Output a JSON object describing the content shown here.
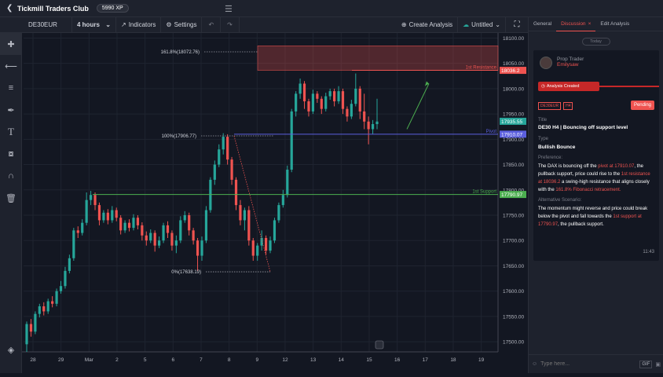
{
  "app": {
    "title": "Tickmill Traders Club",
    "xp": "5990 XP"
  },
  "toolbar": {
    "symbol": "DE30EUR",
    "interval": "4 hours",
    "indicators": "Indicators",
    "settings": "Settings",
    "create_analysis": "Create Analysis",
    "layout_name": "Untitled"
  },
  "tools": [
    "crosshair-icon",
    "horizontal-line-icon",
    "fib-retracement-icon",
    "brush-icon",
    "text-icon",
    "pattern-icon",
    "magnet-icon",
    "trash-icon"
  ],
  "colors": {
    "up": "#26a69a",
    "down": "#ef5350",
    "pivot": "#5b5fde",
    "support": "#4caf50",
    "resistance": "#ef5350"
  },
  "chart_data": {
    "type": "candlestick",
    "symbol": "DE30EUR",
    "interval": "4 hours",
    "ylim": [
      17480,
      18110
    ],
    "y_ticks": [
      17500,
      17550,
      17600,
      17650,
      17700,
      17750,
      17800,
      17850,
      17900,
      17950,
      18000,
      18050,
      18100
    ],
    "y_tick_labels": [
      "17500.00",
      "17550.00",
      "17600.00",
      "17650.00",
      "17700.00",
      "17750.00",
      "17800.00",
      "17850.00",
      "17900.00",
      "17950.00",
      "18000.00",
      "18050.00",
      "18100.00"
    ],
    "x_tick_labels": [
      "28",
      "29",
      "Mar",
      "2",
      "5",
      "6",
      "7",
      "8",
      "9",
      "12",
      "13",
      "14",
      "15",
      "16",
      "17",
      "18",
      "19"
    ],
    "candles": [
      [
        17495,
        17535,
        17480,
        17540
      ],
      [
        17535,
        17520,
        17510,
        17545
      ],
      [
        17520,
        17555,
        17515,
        17560
      ],
      [
        17555,
        17570,
        17548,
        17575
      ],
      [
        17570,
        17560,
        17552,
        17578
      ],
      [
        17560,
        17580,
        17555,
        17585
      ],
      [
        17580,
        17575,
        17568,
        17590
      ],
      [
        17575,
        17600,
        17570,
        17605
      ],
      [
        17600,
        17610,
        17595,
        17620
      ],
      [
        17610,
        17640,
        17605,
        17648
      ],
      [
        17640,
        17665,
        17635,
        17672
      ],
      [
        17665,
        17720,
        17660,
        17725
      ],
      [
        17720,
        17715,
        17705,
        17728
      ],
      [
        17715,
        17735,
        17710,
        17742
      ],
      [
        17735,
        17780,
        17730,
        17795
      ],
      [
        17780,
        17790,
        17770,
        17798
      ],
      [
        17790,
        17770,
        17760,
        17795
      ],
      [
        17770,
        17740,
        17730,
        17775
      ],
      [
        17740,
        17755,
        17735,
        17760
      ],
      [
        17755,
        17740,
        17732,
        17762
      ],
      [
        17740,
        17760,
        17735,
        17768
      ],
      [
        17760,
        17745,
        17738,
        17765
      ],
      [
        17745,
        17720,
        17712,
        17750
      ],
      [
        17720,
        17735,
        17715,
        17740
      ],
      [
        17735,
        17725,
        17718,
        17742
      ],
      [
        17725,
        17745,
        17720,
        17752
      ],
      [
        17745,
        17730,
        17722,
        17750
      ],
      [
        17730,
        17710,
        17700,
        17736
      ],
      [
        17710,
        17700,
        17690,
        17718
      ],
      [
        17700,
        17715,
        17695,
        17722
      ],
      [
        17715,
        17690,
        17678,
        17720
      ],
      [
        17690,
        17700,
        17685,
        17708
      ],
      [
        17700,
        17730,
        17695,
        17735
      ],
      [
        17730,
        17715,
        17705,
        17738
      ],
      [
        17715,
        17690,
        17680,
        17720
      ],
      [
        17690,
        17700,
        17675,
        17710
      ],
      [
        17700,
        17740,
        17695,
        17748
      ],
      [
        17740,
        17750,
        17735,
        17758
      ],
      [
        17750,
        17720,
        17710,
        17755
      ],
      [
        17720,
        17700,
        17692,
        17725
      ],
      [
        17700,
        17670,
        17640,
        17705
      ],
      [
        17670,
        17700,
        17660,
        17708
      ],
      [
        17700,
        17760,
        17695,
        17768
      ],
      [
        17760,
        17820,
        17755,
        17825
      ],
      [
        17820,
        17850,
        17810,
        17858
      ],
      [
        17850,
        17880,
        17845,
        17890
      ],
      [
        17880,
        17905,
        17870,
        17912
      ],
      [
        17905,
        17860,
        17850,
        17910
      ],
      [
        17860,
        17820,
        17810,
        17865
      ],
      [
        17820,
        17770,
        17760,
        17825
      ],
      [
        17770,
        17740,
        17730,
        17780
      ],
      [
        17740,
        17760,
        17720,
        17765
      ],
      [
        17760,
        17700,
        17690,
        17768
      ],
      [
        17700,
        17670,
        17660,
        17705
      ],
      [
        17670,
        17690,
        17660,
        17695
      ],
      [
        17690,
        17705,
        17680,
        17720
      ],
      [
        17705,
        17680,
        17672,
        17710
      ],
      [
        17680,
        17700,
        17675,
        17708
      ],
      [
        17700,
        17740,
        17695,
        17745
      ],
      [
        17740,
        17770,
        17735,
        17775
      ],
      [
        17770,
        17790,
        17765,
        17800
      ],
      [
        17790,
        17840,
        17785,
        17848
      ],
      [
        17840,
        17955,
        17835,
        17960
      ],
      [
        17955,
        17990,
        17945,
        17995
      ],
      [
        17990,
        18010,
        17980,
        18020
      ],
      [
        18010,
        17975,
        17960,
        18015
      ],
      [
        17975,
        17955,
        17945,
        17980
      ],
      [
        17955,
        17990,
        17950,
        17998
      ],
      [
        17990,
        17980,
        17972,
        17995
      ],
      [
        17980,
        17960,
        17950,
        17985
      ],
      [
        17960,
        17985,
        17955,
        17992
      ],
      [
        17985,
        17995,
        17978,
        18000
      ],
      [
        17995,
        17975,
        17965,
        18000
      ],
      [
        17975,
        17995,
        17970,
        18005
      ],
      [
        17995,
        17960,
        17950,
        18000
      ],
      [
        17960,
        17945,
        17935,
        17965
      ],
      [
        17945,
        17970,
        17940,
        17978
      ],
      [
        17970,
        18000,
        17965,
        18030
      ],
      [
        18000,
        17955,
        17940,
        18005
      ],
      [
        17955,
        17935,
        17920,
        17990
      ],
      [
        17935,
        17920,
        17890,
        17945
      ],
      [
        17920,
        17930,
        17910,
        17938
      ],
      [
        17930,
        17935,
        17920,
        17980
      ]
    ],
    "levels": [
      {
        "label": "1st Resistance",
        "price_label": "18036.2",
        "value": 18036.2
      },
      {
        "label": "Pivot",
        "price_label": "17910.07",
        "value": 17910.07
      },
      {
        "label": "1st Support",
        "price_label": "17790.97",
        "value": 17790.97
      }
    ],
    "last_price_label": "17935.55",
    "last_price": 17935.55,
    "fibonacci": [
      {
        "label": "161.8%(18072.76)",
        "value": 18072.76
      },
      {
        "label": "100%(17906.77)",
        "value": 17906.77
      },
      {
        "label": "0%(17638.19)",
        "value": 17638.19
      }
    ]
  },
  "panel": {
    "tabs": [
      "General",
      "Discussion",
      "Edit Analysis"
    ],
    "today": "Today",
    "author_role": "Prop Trader",
    "author_name": "Emilysaw",
    "created": "Analysis Created",
    "tags": [
      "DE30EUR",
      "H4"
    ],
    "status": "Pending",
    "title_label": "Title",
    "title_value": "DE30 H4 | Bouncing off support level",
    "type_label": "Type",
    "type_value": "Bullish Bounce",
    "pref_label": "Preference:",
    "pref_parts": [
      "The DAX is bouncing off the ",
      "pivot at 17910.07",
      ", the pullback support, price could rise to the ",
      "1st resistance at 18036.2",
      " a swing-high resistance that aligns closely with the ",
      "161.8% Fibonacci retracement."
    ],
    "alt_label": "Alternative Scenario:",
    "alt_parts": [
      "The momentum might reverse and price could break below the pivot and fall towards the ",
      "1st support at 17790.97",
      ", the pullback support."
    ],
    "time": "11:43",
    "chat_placeholder": "Type here...",
    "gif": "GIF"
  }
}
